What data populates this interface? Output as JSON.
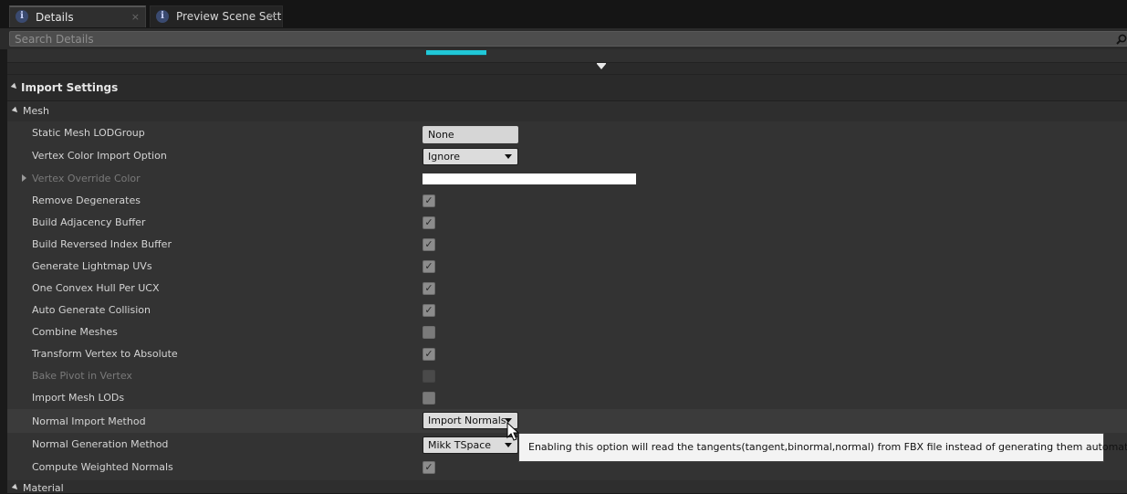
{
  "tabs": [
    {
      "label": "Details",
      "close": "×"
    },
    {
      "label": "Preview Scene Sett",
      "close": "×"
    }
  ],
  "search": {
    "placeholder": "Search Details"
  },
  "section": {
    "title": "Import Settings"
  },
  "categories": {
    "mesh": "Mesh",
    "material": "Material"
  },
  "properties": [
    {
      "label": "Static Mesh LODGroup",
      "type": "combo",
      "value": "None"
    },
    {
      "label": "Vertex Color Import Option",
      "type": "combo",
      "value": "Ignore"
    },
    {
      "label": "Vertex Override Color",
      "type": "color",
      "value": "#ffffff"
    },
    {
      "label": "Remove Degenerates",
      "type": "checkbox",
      "checked": true
    },
    {
      "label": "Build Adjacency Buffer",
      "type": "checkbox",
      "checked": true
    },
    {
      "label": "Build Reversed Index Buffer",
      "type": "checkbox",
      "checked": true
    },
    {
      "label": "Generate Lightmap UVs",
      "type": "checkbox",
      "checked": true
    },
    {
      "label": "One Convex Hull Per UCX",
      "type": "checkbox",
      "checked": true
    },
    {
      "label": "Auto Generate Collision",
      "type": "checkbox",
      "checked": true
    },
    {
      "label": "Combine Meshes",
      "type": "checkbox",
      "checked": false
    },
    {
      "label": "Transform Vertex to Absolute",
      "type": "checkbox",
      "checked": true
    },
    {
      "label": "Bake Pivot in Vertex",
      "type": "checkbox",
      "checked": false,
      "disabled": true
    },
    {
      "label": "Import Mesh LODs",
      "type": "checkbox",
      "checked": false
    },
    {
      "label": "Normal Import Method",
      "type": "combo",
      "value": "Import Normals"
    },
    {
      "label": "Normal Generation Method",
      "type": "combo",
      "value": "Mikk TSpace"
    },
    {
      "label": "Compute Weighted Normals",
      "type": "checkbox",
      "checked": true
    }
  ],
  "tooltip": {
    "text": "Enabling this option will read the tangents(tangent,binormal,normal) from FBX file instead of generating them automatically."
  },
  "colors": {
    "accent_cyan": "#20c8d8",
    "panel": "#333333",
    "background": "#1a1a1a"
  }
}
